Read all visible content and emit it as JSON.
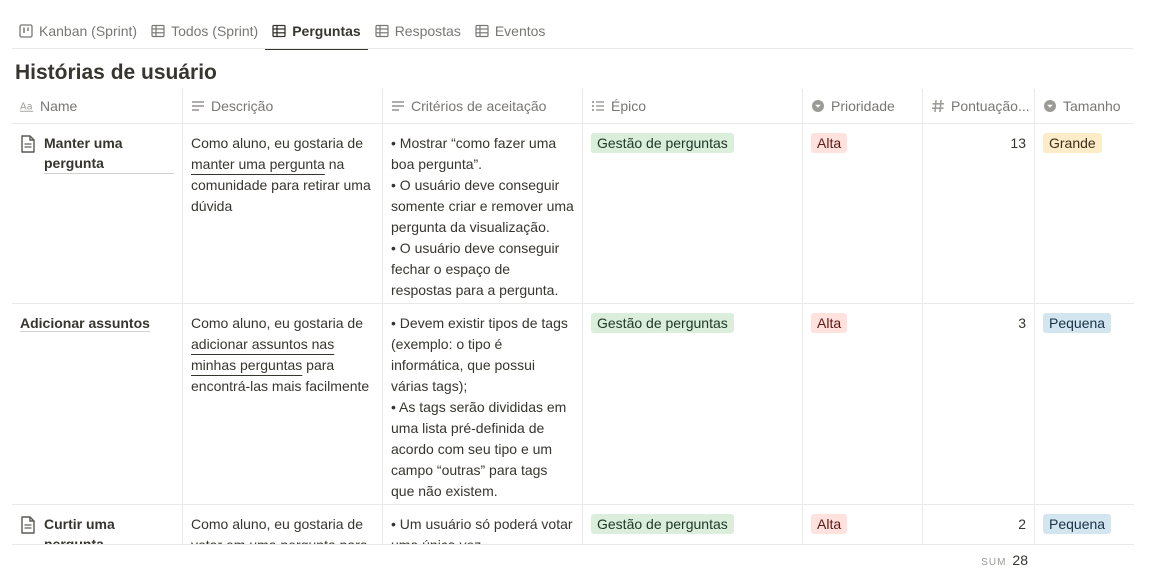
{
  "tabs": [
    {
      "label": "Kanban (Sprint)",
      "icon": "board-icon",
      "active": false
    },
    {
      "label": "Todos (Sprint)",
      "icon": "table-icon",
      "active": false
    },
    {
      "label": "Perguntas",
      "icon": "table-icon",
      "active": true
    },
    {
      "label": "Respostas",
      "icon": "table-icon",
      "active": false
    },
    {
      "label": "Eventos",
      "icon": "table-icon",
      "active": false
    }
  ],
  "title": "Histórias de usuário",
  "columns": {
    "name": "Name",
    "description": "Descrição",
    "criteria": "Critérios de aceitação",
    "epic": "Épico",
    "priority": "Prioridade",
    "points": "Pontuação...",
    "size": "Tamanho"
  },
  "rows": [
    {
      "name": "Manter uma pergunta",
      "has_doc_icon": true,
      "description": {
        "pre": "Como aluno, eu gostaria de ",
        "link": "manter uma pergunta",
        "post": " na comunidade para retirar uma dúvida"
      },
      "criteria": [
        "• Mostrar “como fazer uma boa pergunta”.",
        "• O usuário deve conseguir somente criar e remover uma pergunta da visualização.",
        "• O usuário deve conseguir fechar o espaço de respostas para a pergunta."
      ],
      "epic": "Gestão de perguntas",
      "priority": "Alta",
      "points": "13",
      "size": "Grande"
    },
    {
      "name": "Adicionar assuntos",
      "has_doc_icon": false,
      "description": {
        "pre": "Como aluno, eu gostaria de ",
        "link": "adicionar assuntos nas minhas perguntas",
        "post": " para encontrá-las mais facilmente"
      },
      "criteria": [
        "• Devem existir tipos de tags (exemplo: o tipo é informática, que possui várias tags);",
        "• As tags serão divididas em uma lista pré-definida de acordo com seu tipo e um campo “outras” para tags que não existem."
      ],
      "epic": "Gestão de perguntas",
      "priority": "Alta",
      "points": "3",
      "size": "Pequena"
    },
    {
      "name": "Curtir uma pergunta",
      "has_doc_icon": true,
      "description": {
        "pre": "Como aluno, eu gostaria de votar em uma pergunta para",
        "link": "",
        "post": ""
      },
      "criteria": [
        "• Um usuário só poderá votar uma única vez"
      ],
      "epic": "Gestão de perguntas",
      "priority": "Alta",
      "points": "2",
      "size": "Pequena"
    }
  ],
  "sum": {
    "label": "SUM",
    "value": "28"
  },
  "colors": {
    "epic_bg": "#dbeddb",
    "epic_fg": "#1c3829",
    "priority_bg": "#ffe2dd",
    "priority_fg": "#5d1715",
    "size_large_bg": "#fdecc8",
    "size_large_fg": "#402c1b",
    "size_small_bg": "#d3e5ef",
    "size_small_fg": "#183347"
  }
}
